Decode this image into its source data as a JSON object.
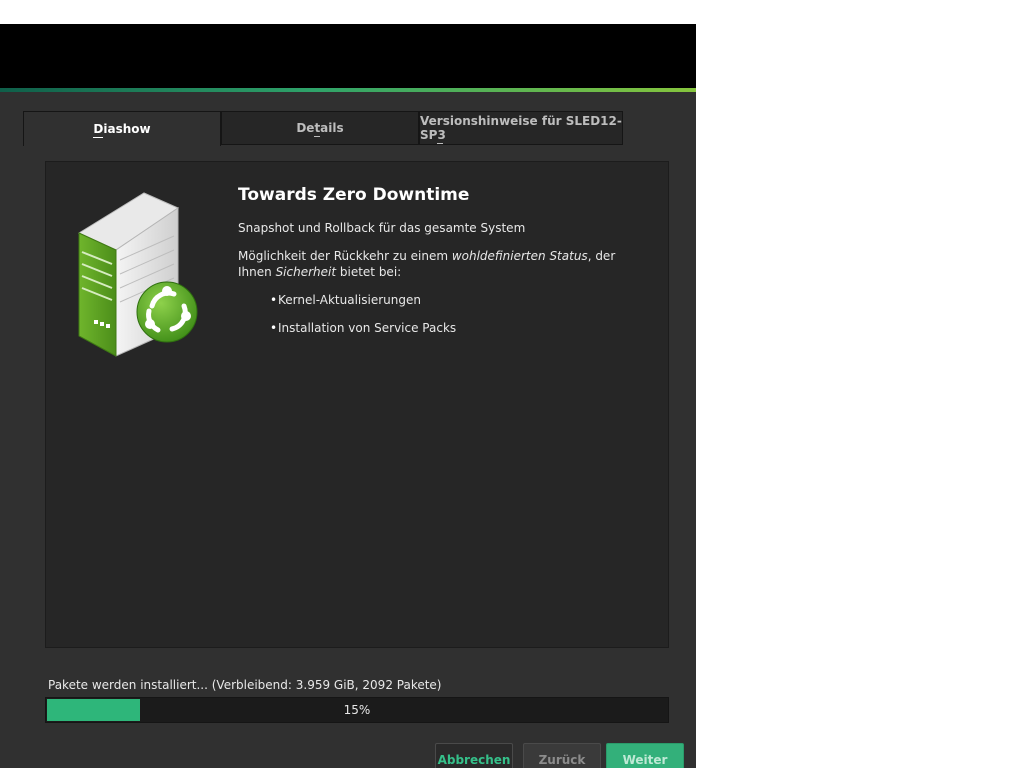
{
  "window": {
    "accent_colors": [
      "#0f5f4a",
      "#86c53d"
    ]
  },
  "tabs": [
    {
      "label": "Diashow",
      "mnemonic_index": 0,
      "active": true
    },
    {
      "label": "Details",
      "mnemonic_index": 2,
      "active": false
    },
    {
      "label": "Versionshinweise für SLED12-SP3",
      "mnemonic_index": 2,
      "active": false
    }
  ],
  "slide": {
    "icon": "server-refresh-icon",
    "title": "Towards Zero Downtime",
    "subtitle": "Snapshot und Rollback für das gesamte System",
    "paragraph": {
      "text1": "Möglichkeit der Rückkehr zu einem ",
      "em1": "wohldefinierten Status",
      "text2": ", der Ihnen ",
      "em2": "Sicherheit",
      "text3": " bietet bei:"
    },
    "bullets": [
      "Kernel-Aktualisierungen",
      "Installation von Service Packs"
    ]
  },
  "install": {
    "status_text": "Pakete werden installiert... (Verbleibend: 3.959 GiB,  2092 Pakete)",
    "progress_percent": 15,
    "progress_label": "15%",
    "progress_color": "#2eb67a"
  },
  "buttons": {
    "abbrechen": {
      "label": "Abbrechen",
      "mnemonic_index": 0
    },
    "zurueck": {
      "label": "Zurück",
      "mnemonic_index": 0
    },
    "weiter": {
      "label": "Weiter",
      "mnemonic_index": 0
    }
  }
}
